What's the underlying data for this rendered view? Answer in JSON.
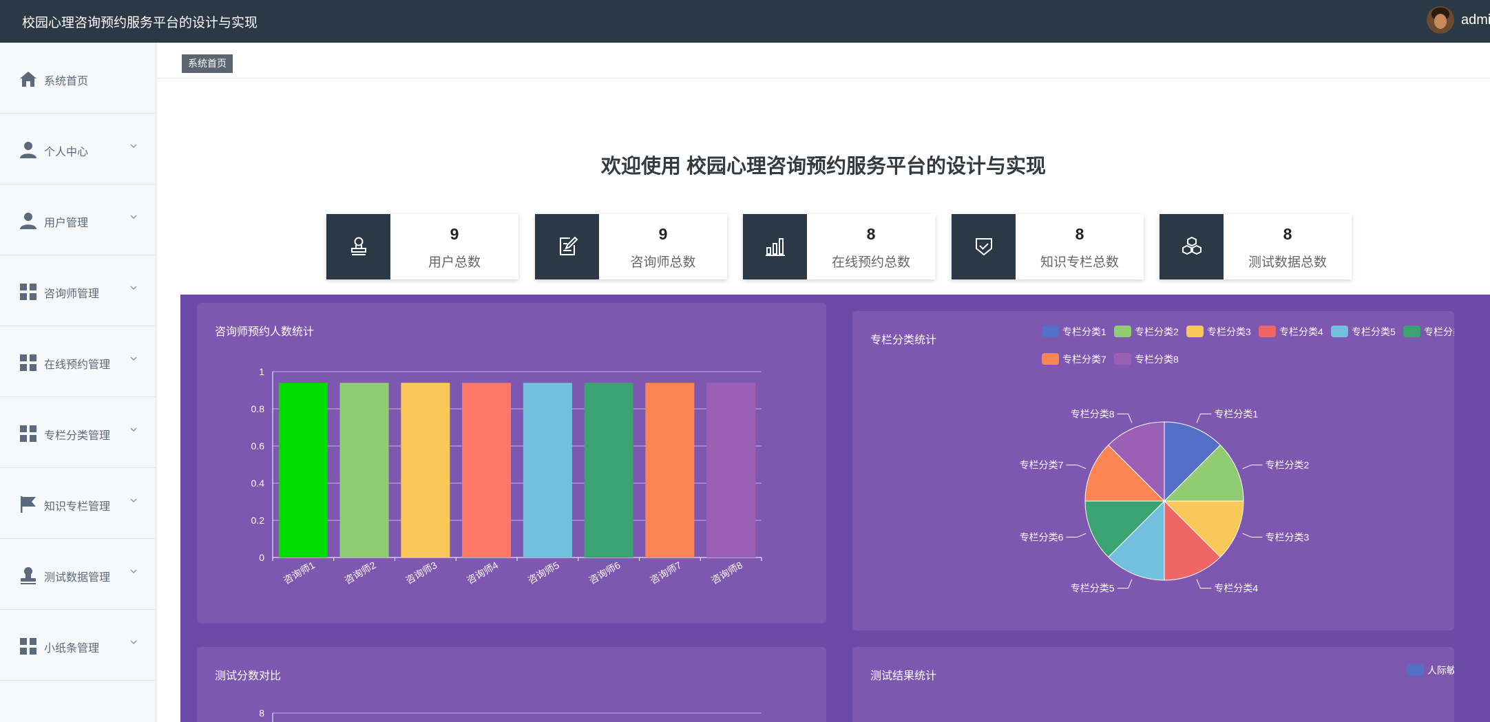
{
  "header": {
    "title": "校园心理咨询预约服务平台的设计与实现",
    "user": "admin"
  },
  "sidebar": {
    "items": [
      {
        "label": "系统首页",
        "icon": "home-icon",
        "expandable": false
      },
      {
        "label": "个人中心",
        "icon": "user-icon",
        "expandable": true
      },
      {
        "label": "用户管理",
        "icon": "user-icon",
        "expandable": true
      },
      {
        "label": "咨询师管理",
        "icon": "grid-icon",
        "expandable": true
      },
      {
        "label": "在线预约管理",
        "icon": "grid-icon",
        "expandable": true
      },
      {
        "label": "专栏分类管理",
        "icon": "grid-icon",
        "expandable": true
      },
      {
        "label": "知识专栏管理",
        "icon": "flag-icon",
        "expandable": true
      },
      {
        "label": "测试数据管理",
        "icon": "stamp-icon",
        "expandable": true
      },
      {
        "label": "小纸条管理",
        "icon": "grid-icon",
        "expandable": true
      }
    ]
  },
  "breadcrumb": {
    "label": "系统首页"
  },
  "welcome": "欢迎使用 校园心理咨询预约服务平台的设计与实现",
  "stats": [
    {
      "value": "9",
      "label": "用户总数",
      "icon": "stamp-icon"
    },
    {
      "value": "9",
      "label": "咨询师总数",
      "icon": "edit-icon"
    },
    {
      "value": "8",
      "label": "在线预约总数",
      "icon": "bar-chart-icon"
    },
    {
      "value": "8",
      "label": "知识专栏总数",
      "icon": "shield-check-icon"
    },
    {
      "value": "8",
      "label": "测试数据总数",
      "icon": "cubes-icon"
    }
  ],
  "panels": {
    "consultant_chart_title": "咨询师预约人数统计",
    "column_chart_title": "专栏分类统计",
    "score_chart_title": "测试分数对比",
    "result_chart_title": "测试结果统计"
  },
  "colors": {
    "topbar": "#2b3845",
    "dashboard": "#6b4aa8",
    "panel": "#7e58b0",
    "palette": [
      "#5470c6",
      "#91cc75",
      "#fac858",
      "#ee6666",
      "#73c0de",
      "#3ba272",
      "#fc8452",
      "#9a60b4"
    ]
  },
  "chart_data": [
    {
      "type": "bar",
      "categories": [
        "咨询师1",
        "咨询师2",
        "咨询师3",
        "咨询师4",
        "咨询师5",
        "咨询师6",
        "咨询师7",
        "咨询师8"
      ],
      "values": [
        0.94,
        0.94,
        0.94,
        0.94,
        0.94,
        0.94,
        0.94,
        0.94
      ],
      "bar_colors": [
        "#00dd00",
        "#91cc75",
        "#fac858",
        "#ff7766",
        "#73c0de",
        "#3ba272",
        "#fc8452",
        "#9a60b4"
      ],
      "ylim": [
        0,
        1
      ],
      "yticks": [
        "0",
        "0.2",
        "0.4",
        "0.6",
        "0.8",
        "1"
      ],
      "grid": true
    },
    {
      "type": "pie",
      "labels": [
        "专栏分类1",
        "专栏分类2",
        "专栏分类3",
        "专栏分类4",
        "专栏分类5",
        "专栏分类6",
        "专栏分类7",
        "专栏分类8"
      ],
      "values": [
        1,
        1,
        1,
        1,
        1,
        1,
        1,
        1
      ],
      "legend": "top-right"
    },
    {
      "type": "bar",
      "yticks_visible": [
        "8"
      ],
      "grid": true
    },
    {
      "type": "bar",
      "legend_entries": [
        "人际敏感"
      ],
      "legend": "top-right"
    }
  ]
}
